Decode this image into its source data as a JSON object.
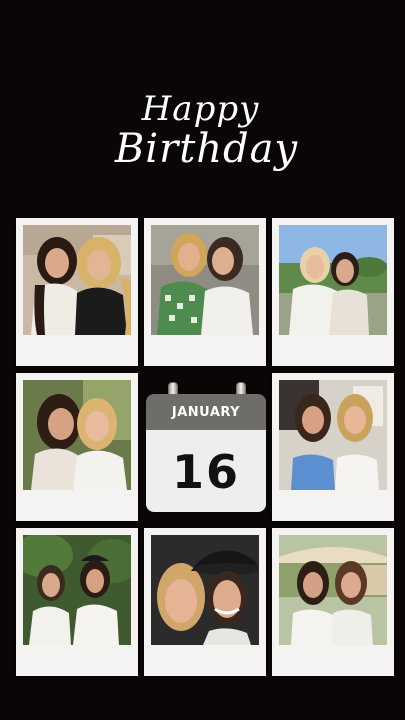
{
  "title": {
    "line1": "Happy",
    "line2": "Birthday"
  },
  "calendar": {
    "month": "JANUARY",
    "day": "16"
  },
  "colors": {
    "background": "#0a0606",
    "polaroid_frame": "#f4f3f1",
    "calendar_header": "#6f6d6a",
    "calendar_body": "#eeeeec"
  },
  "photos": [
    {
      "name": "photo-1",
      "scene": "two-friends-indoor"
    },
    {
      "name": "photo-2",
      "scene": "two-friends-hug"
    },
    {
      "name": "photo-3",
      "scene": "two-friends-park"
    },
    {
      "name": "photo-4",
      "scene": "two-friends-selfie"
    },
    {
      "name": "photo-5",
      "scene": "two-friends-closet"
    },
    {
      "name": "photo-6",
      "scene": "two-friends-garden"
    },
    {
      "name": "photo-7",
      "scene": "two-friends-cowboy-hat"
    },
    {
      "name": "photo-8",
      "scene": "two-friends-patio"
    }
  ]
}
